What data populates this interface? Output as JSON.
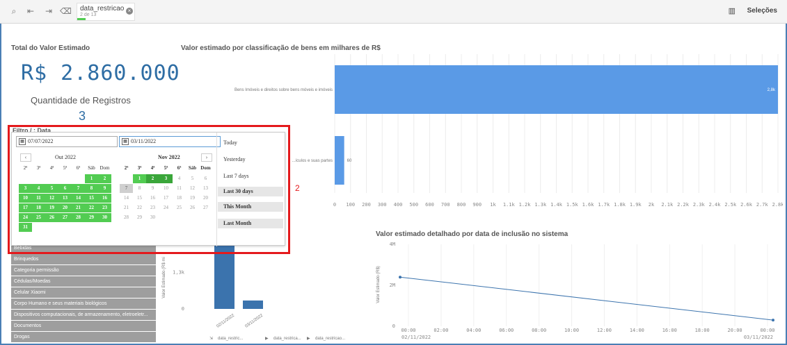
{
  "topbar": {
    "selection_title": "data_restricao",
    "selection_sub": "2 de 13",
    "selecoes_label": "Seleções"
  },
  "kpi": {
    "title": "Total do Valor Estimado",
    "value": "R$ 2.860.000",
    "records_title": "Quantidade de Registros",
    "records_value": "3"
  },
  "filter": {
    "label": "Filtro / : Data",
    "start_date": "07/07/2022",
    "end_date": "03/11/2022",
    "left_month": "Out 2022",
    "right_month": "Nov 2022",
    "weekdays": [
      "2ª",
      "3ª",
      "4ª",
      "5ª",
      "6ª",
      "Sáb",
      "Dom"
    ],
    "quick_ranges": [
      "Today",
      "Yesterday",
      "Last 7 days",
      "Last 30 days",
      "This Month",
      "Last Month"
    ],
    "annotation": "2"
  },
  "categories_list": [
    "Bebidas",
    "Brinquedos",
    "Categoria permissão",
    "Cédulas/Moedas",
    "Celular Xiaomi",
    "Corpo Humano e seus materiais biológicos",
    "Dispositivos computacionais, de armazenamento, eletroeletr...",
    "Documentos",
    "Drogas"
  ],
  "charts": {
    "bar_title": "Valor estimado por classificação de bens em milhares de R$",
    "line_title": "Valor estimado detalhado por data de inclusão no sistema",
    "col_ylabel": "Valor Estimado (R$ mi",
    "line_ylabel": "Valor Estimado (R$)",
    "col_nav": [
      "data_restric...",
      "data_restrica...",
      "data_restricao..."
    ]
  },
  "chart_data": [
    {
      "type": "bar",
      "orientation": "horizontal",
      "title": "Valor estimado por classificação de bens em milhares de R$",
      "categories": [
        "Bens Imóveis e direitos sobre bens móveis e imóveis",
        "...ículos e suas partes"
      ],
      "values": [
        2800,
        60
      ],
      "data_labels": [
        "2,8k",
        "60"
      ],
      "x_ticks": [
        "0",
        "100",
        "200",
        "300",
        "400",
        "500",
        "600",
        "700",
        "800",
        "900",
        "1k",
        "1.1k",
        "1.2k",
        "1.3k",
        "1.4k",
        "1.5k",
        "1.6k",
        "1.7k",
        "1.8k",
        "1.9k",
        "2k",
        "2.1k",
        "2.2k",
        "2.3k",
        "2.4k",
        "2.5k",
        "2.6k",
        "2.7k",
        "2.8k"
      ],
      "xlim": [
        0,
        2800
      ],
      "color": "#5a9ae6"
    },
    {
      "type": "bar",
      "title": "",
      "categories": [
        "02/11/2022",
        "03/11/2022"
      ],
      "values": [
        2560,
        300
      ],
      "y_ticks": [
        "0",
        "1,3k"
      ],
      "ylabel": "Valor Estimado (R$ mi",
      "color": "#3b73ad"
    },
    {
      "type": "line",
      "title": "Valor estimado detalhado por data de inclusão no sistema",
      "x_ticks": [
        "00:00",
        "02:00",
        "04:00",
        "06:00",
        "08:00",
        "10:00",
        "12:00",
        "14:00",
        "16:00",
        "18:00",
        "20:00",
        "00:00"
      ],
      "x_dates": [
        "02/11/2022",
        "03/11/2022"
      ],
      "y_ticks": [
        "0",
        "2M",
        "4M"
      ],
      "ylim": [
        0,
        4000000
      ],
      "ylabel": "Valor Estimado (R$)",
      "points": [
        {
          "x": "02/11/2022 00:00",
          "y": 2400000
        },
        {
          "x": "03/11/2022 00:00",
          "y": 300000
        }
      ],
      "color": "#3b73ad"
    }
  ]
}
